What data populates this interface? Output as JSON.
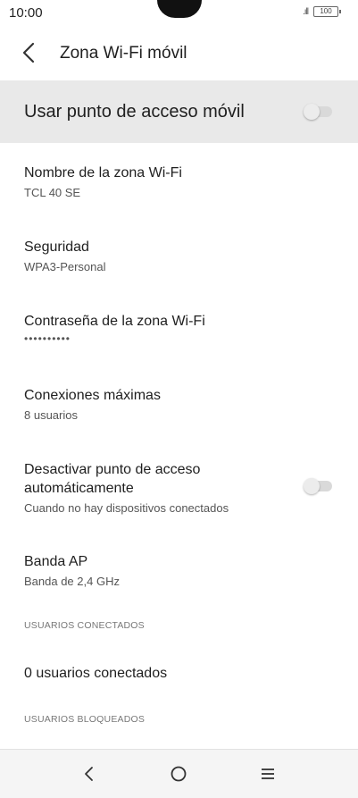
{
  "status_bar": {
    "time": "10:00",
    "battery": "100"
  },
  "header": {
    "title": "Zona Wi-Fi móvil"
  },
  "master_toggle": {
    "label": "Usar punto de acceso móvil"
  },
  "settings": {
    "hotspot_name": {
      "title": "Nombre de la zona Wi-Fi",
      "value": "TCL 40 SE"
    },
    "security": {
      "title": "Seguridad",
      "value": "WPA3-Personal"
    },
    "password": {
      "title": "Contraseña de la zona Wi-Fi",
      "value": "••••••••••"
    },
    "max_connections": {
      "title": "Conexiones máximas",
      "value": "8 usuarios"
    },
    "auto_off": {
      "title": "Desactivar punto de acceso automáticamente",
      "value": "Cuando no hay dispositivos conectados"
    },
    "ap_band": {
      "title": "Banda AP",
      "value": "Banda de 2,4 GHz"
    }
  },
  "sections": {
    "connected_header": "USUARIOS CONECTADOS",
    "connected_users": "0 usuarios conectados",
    "blocked_header": "USUARIOS BLOQUEADOS"
  },
  "icons": {
    "back": "back-arrow-icon",
    "nav_back": "nav-back-icon",
    "nav_home": "nav-home-icon",
    "nav_recents": "nav-menu-icon"
  }
}
